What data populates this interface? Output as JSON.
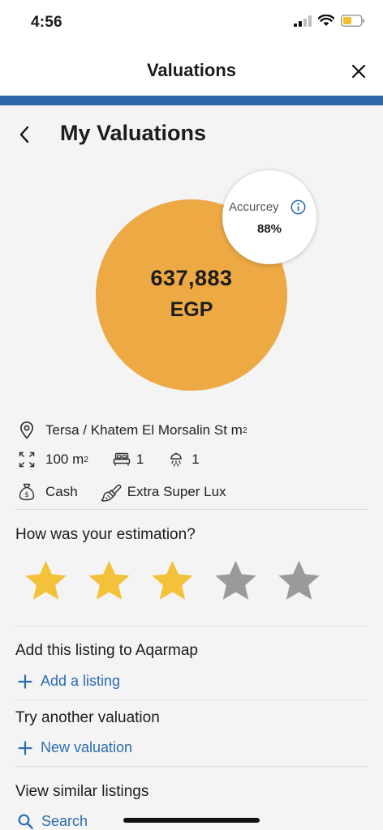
{
  "status_bar": {
    "time": "4:56"
  },
  "header": {
    "title": "Valuations"
  },
  "page": {
    "title": "My Valuations"
  },
  "valuation": {
    "amount": "637,883",
    "currency": "EGP",
    "accuracy_label": "Accurcey",
    "accuracy_value": "88%"
  },
  "details": {
    "location": "Tersa / Khatem El Morsalin St m",
    "area_value": "100 m",
    "bedrooms": "1",
    "bathrooms": "1",
    "payment": "Cash",
    "finishing": "Extra Super Lux"
  },
  "rating": {
    "question": "How was your estimation?",
    "selected_stars": 3,
    "total_stars": 5
  },
  "actions": {
    "add_listing_title": "Add this listing to Aqarmap",
    "add_listing_link": "Add a listing",
    "another_valuation_title": "Try another valuation",
    "new_valuation_link": "New valuation",
    "similar_title": "View similar listings",
    "search_link": "Search"
  },
  "colors": {
    "accent_blue": "#2f66a8",
    "link_blue": "#2c6cb0",
    "value_orange": "#eca944",
    "star_selected": "#f4c23a",
    "star_unselected": "#9a9a9a"
  }
}
